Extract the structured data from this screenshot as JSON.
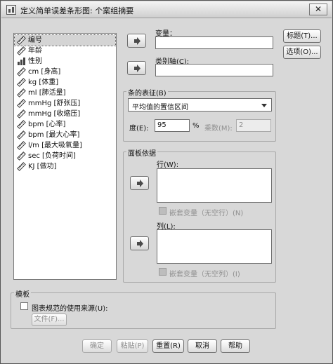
{
  "window": {
    "title": "定义简单误差条形图: 个案组摘要",
    "close_glyph": "✕"
  },
  "variables": [
    {
      "label": "编号",
      "icon": "scale-ruler-icon",
      "selected": true
    },
    {
      "label": "年龄",
      "icon": "scale-ruler-icon"
    },
    {
      "label": "性别",
      "icon": "nominal-bars-icon"
    },
    {
      "label": "cm [身高]",
      "icon": "scale-ruler-icon"
    },
    {
      "label": "kg [体重]",
      "icon": "scale-ruler-icon"
    },
    {
      "label": "ml [肺活量]",
      "icon": "scale-ruler-icon"
    },
    {
      "label": "mmHg [舒张压]",
      "icon": "scale-ruler-icon"
    },
    {
      "label": "mmHg [收缩压]",
      "icon": "scale-ruler-icon"
    },
    {
      "label": "bpm [心率]",
      "icon": "scale-ruler-icon"
    },
    {
      "label": "bpm [最大心率]",
      "icon": "scale-ruler-icon"
    },
    {
      "label": "l/m [最大吸氧量]",
      "icon": "scale-ruler-icon"
    },
    {
      "label": "sec [负荷时间]",
      "icon": "scale-ruler-icon"
    },
    {
      "label": "KJ [做功]",
      "icon": "scale-ruler-icon"
    }
  ],
  "fields": {
    "variable_label": "变量：",
    "category_axis_label": "类别轴(C):"
  },
  "bars_represent": {
    "title": "条的表征(B)",
    "selected": "平均值的置信区间",
    "degree_label": "度(E):",
    "degree_value": "95",
    "percent": "%",
    "multiplier_label": "乘数(M):",
    "multiplier_value": "2"
  },
  "panel": {
    "title": "面板依据",
    "rows_label": "行(W):",
    "rows_nest": "嵌套变量（无空行）(N)",
    "cols_label": "列(L):",
    "cols_nest": "嵌套变量（无空列）(I)"
  },
  "side_buttons": {
    "titles": "标题(T)...",
    "options": "选项(O)..."
  },
  "template": {
    "title": "模板",
    "use_chart_spec": "图表规范的使用来源(U):",
    "file_button": "文件(F)..."
  },
  "footer": {
    "ok": "确定",
    "paste": "粘贴(P)",
    "reset": "重置(R)",
    "cancel": "取消",
    "help": "帮助"
  }
}
